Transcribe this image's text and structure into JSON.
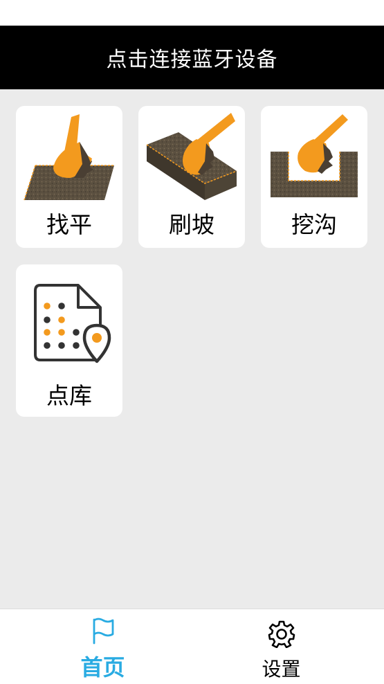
{
  "header": {
    "title": "点击连接蓝牙设备"
  },
  "cards": [
    {
      "label": "找平",
      "icon": "excavator-leveling-icon"
    },
    {
      "label": "刷坡",
      "icon": "excavator-slope-icon"
    },
    {
      "label": "挖沟",
      "icon": "excavator-trench-icon"
    },
    {
      "label": "点库",
      "icon": "point-library-icon"
    }
  ],
  "tabbar": {
    "tabs": [
      {
        "label": "首页",
        "icon": "flag-icon",
        "active": true
      },
      {
        "label": "设置",
        "icon": "gear-icon",
        "active": false
      }
    ]
  },
  "colors": {
    "accent": "#29abe2",
    "bucket": "#f39a1e",
    "soil": "#5b5040",
    "header_bg": "#000000",
    "background": "#ebebeb"
  }
}
